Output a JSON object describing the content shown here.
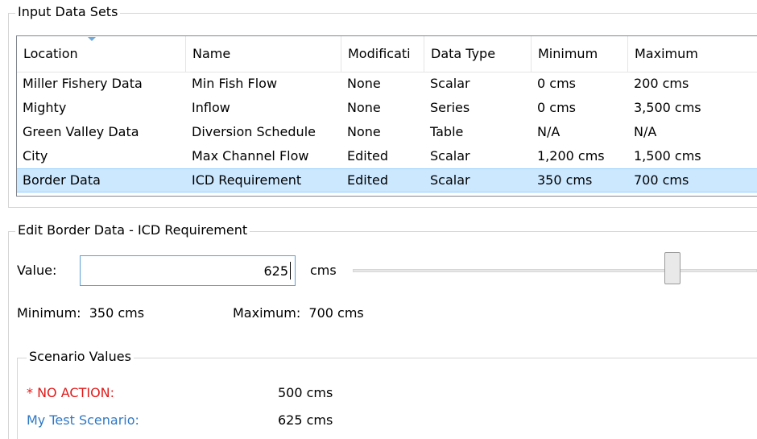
{
  "input_data_sets": {
    "title": "Input Data Sets",
    "columns": [
      "Location",
      "Name",
      "Modificati",
      "Data Type",
      "Minimum",
      "Maximum"
    ],
    "rows": [
      {
        "location": "Miller Fishery Data",
        "name": "Min Fish Flow",
        "modification": "None",
        "data_type": "Scalar",
        "minimum": "0 cms",
        "maximum": "200 cms",
        "selected": false
      },
      {
        "location": "Mighty",
        "name": "Inflow",
        "modification": "None",
        "data_type": "Series",
        "minimum": "0 cms",
        "maximum": "3,500 cms",
        "selected": false
      },
      {
        "location": "Green Valley Data",
        "name": "Diversion Schedule",
        "modification": "None",
        "data_type": "Table",
        "minimum": "N/A",
        "maximum": "N/A",
        "selected": false
      },
      {
        "location": "City",
        "name": "Max Channel Flow",
        "modification": "Edited",
        "data_type": "Scalar",
        "minimum": "1,200 cms",
        "maximum": "1,500 cms",
        "selected": false
      },
      {
        "location": "Border Data",
        "name": "ICD Requirement",
        "modification": "Edited",
        "data_type": "Scalar",
        "minimum": "350 cms",
        "maximum": "700 cms",
        "selected": true
      }
    ]
  },
  "edit": {
    "title": "Edit Border Data - ICD Requirement",
    "value_label": "Value:",
    "value": "625",
    "unit": "cms",
    "slider_fraction": 0.79,
    "minimum_text": "Minimum:  350 cms",
    "maximum_text": "Maximum:  700 cms"
  },
  "scenario_values": {
    "title": "Scenario Values",
    "items": [
      {
        "label": "* NO ACTION:",
        "value": "500 cms",
        "color": "#e21a1a"
      },
      {
        "label": "My Test Scenario:",
        "value": "625 cms",
        "color": "#2f78c4"
      }
    ]
  }
}
